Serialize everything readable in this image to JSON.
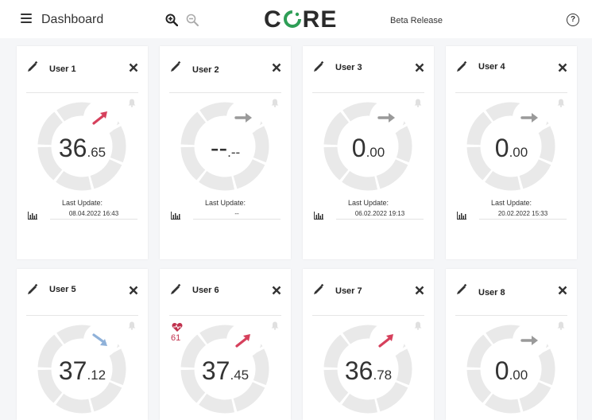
{
  "header": {
    "title": "Dashboard",
    "logo_parts": [
      "C",
      "RE"
    ],
    "release": "Beta Release",
    "help": "?"
  },
  "labels": {
    "last_update": "Last Update:"
  },
  "colors": {
    "trend_up": "#d6405c",
    "trend_flat": "#9a9a9a",
    "trend_down": "#8fb1d9",
    "gauge": "#e9e9e9",
    "heart": "#c0314d"
  },
  "users": [
    {
      "name": "User 1",
      "int": "36",
      "dec": ".65",
      "trend": "up",
      "icon": "arrow-up-right-icon",
      "date": "08.04.2022 16:43"
    },
    {
      "name": "User 2",
      "int": "--",
      "dec": ".--",
      "trend": "flat",
      "icon": "arrow-right-icon",
      "date": "--"
    },
    {
      "name": "User 3",
      "int": "0",
      "dec": ".00",
      "trend": "flat",
      "icon": "arrow-right-icon",
      "date": "06.02.2022 19:13"
    },
    {
      "name": "User 4",
      "int": "0",
      "dec": ".00",
      "trend": "flat",
      "icon": "arrow-right-icon",
      "date": "20.02.2022 15:33"
    },
    {
      "name": "User 5",
      "int": "37",
      "dec": ".12",
      "trend": "down",
      "icon": "arrow-down-right-icon"
    },
    {
      "name": "User 6",
      "int": "37",
      "dec": ".45",
      "trend": "up",
      "icon": "arrow-up-right-icon",
      "pulse": "61"
    },
    {
      "name": "User 7",
      "int": "36",
      "dec": ".78",
      "trend": "up",
      "icon": "arrow-up-right-icon"
    },
    {
      "name": "User 8",
      "int": "0",
      "dec": ".00",
      "trend": "flat",
      "icon": "arrow-right-icon"
    }
  ]
}
